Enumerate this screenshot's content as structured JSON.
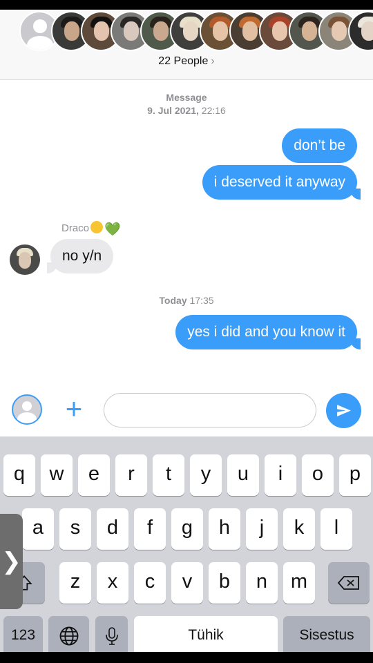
{
  "header": {
    "people_label": "22 People",
    "chevron": "›"
  },
  "participants": [
    {
      "name": "participant-1",
      "skin": "#c9a58a",
      "hair": "#1c1a18",
      "bg": "#3a3a38"
    },
    {
      "name": "participant-2",
      "skin": "#e3c4ae",
      "hair": "#141210",
      "bg": "#5d4a3b"
    },
    {
      "name": "participant-3",
      "skin": "#d8c8bd",
      "hair": "#2a2827",
      "bg": "#7a7a78"
    },
    {
      "name": "participant-4",
      "skin": "#c9a88f",
      "hair": "#2b221b",
      "bg": "#4f5a4a"
    },
    {
      "name": "participant-5",
      "skin": "#e6d6c4",
      "hair": "#e8e0c8",
      "bg": "#3f403e"
    },
    {
      "name": "participant-6",
      "skin": "#e4c3a6",
      "hair": "#b25a2a",
      "bg": "#6a5136"
    },
    {
      "name": "participant-7",
      "skin": "#e0bfa2",
      "hair": "#c06a31",
      "bg": "#4a3e33"
    },
    {
      "name": "participant-8",
      "skin": "#e7c6ad",
      "hair": "#a8432a",
      "bg": "#6a4a3a"
    },
    {
      "name": "participant-9",
      "skin": "#d6b395",
      "hair": "#2c241d",
      "bg": "#52564d"
    },
    {
      "name": "participant-10",
      "skin": "#e6c9b3",
      "hair": "#7a5236",
      "bg": "#8b8579"
    },
    {
      "name": "participant-11",
      "skin": "#e3d4c7",
      "hair": "#ece7dc",
      "bg": "#2c2c2c"
    }
  ],
  "conversation": {
    "timestamp_1_label": "Message",
    "timestamp_1_date": "9. Jul 2021,",
    "timestamp_1_time": "22:16",
    "messages": [
      {
        "text": "don’t be"
      },
      {
        "text": "i deserved it anyway"
      },
      {
        "sender": "Draco",
        "text": "no y/n"
      },
      {
        "text": "yes i did and you know it"
      }
    ],
    "timestamp_2_day": "Today",
    "timestamp_2_time": "17:35",
    "heart_emoji": "💚"
  },
  "input_bar": {
    "plus": "+",
    "text_value": ""
  },
  "keyboard": {
    "row1": [
      "q",
      "w",
      "e",
      "r",
      "t",
      "y",
      "u",
      "i",
      "o",
      "p"
    ],
    "row2": [
      "a",
      "s",
      "d",
      "f",
      "g",
      "h",
      "j",
      "k",
      "l"
    ],
    "row3": [
      "z",
      "x",
      "c",
      "v",
      "b",
      "n",
      "m"
    ],
    "numbers_key": "123",
    "space_key": "Tühik",
    "return_key": "Sisestus",
    "side_tab": "❯"
  },
  "colors": {
    "outgoing_bubble": "#3a9df9",
    "incoming_bubble": "#e9e9eb",
    "keyboard_bg": "#d2d4da"
  }
}
